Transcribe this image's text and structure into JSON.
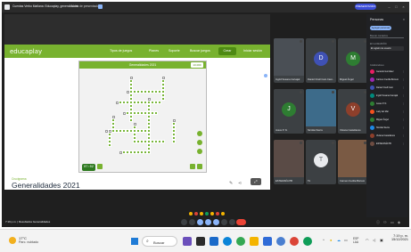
{
  "meet_header": {
    "title": "Cuentas Verbo Mañana: Educaplay, generalidades",
    "tag": "Modo de presentación",
    "pill_label": "PRESENTANDO"
  },
  "educaplay": {
    "logo": "educaplay",
    "nav": [
      "Tipos de juegos",
      "Planes",
      "Soporte",
      "Buscar juegos"
    ],
    "create_label": "Crear",
    "login_label": "Iniciar sesión",
    "game_header_title": "Generalidades 2021",
    "score": "10.000",
    "timer": "07:02",
    "category": "Crucigrama",
    "game_name": "Generalidades 2021",
    "colors": {
      "brand": "#78b22f",
      "dark": "#4e8a13",
      "cell": "#79b63a"
    }
  },
  "participants": [
    {
      "name": "Ingrid Susana Carvajal",
      "kind": "photo",
      "color": "#4a4f55"
    },
    {
      "name": "Daniel Onell Caro Cast...",
      "kind": "avatar",
      "initial": "D",
      "color": "#3f51b5"
    },
    {
      "name": "Miguel Ángel",
      "kind": "avatar",
      "initial": "M",
      "color": "#2e7d32"
    },
    {
      "name": "Jesus P. N.",
      "kind": "avatar",
      "initial": "J",
      "color": "#2e7d32"
    },
    {
      "name": "Nicolás Sierra",
      "kind": "photo",
      "color": "#3d6b8a"
    },
    {
      "name": "Viviana Castellanos",
      "kind": "avatar",
      "initial": "V",
      "color": "#8d3f2b"
    },
    {
      "name": "ESTEFANÍA PB",
      "kind": "photo",
      "color": "#5a4b46"
    },
    {
      "name": "Tú",
      "kind": "avatar",
      "initial": "T",
      "color": "#e8eaed"
    },
    {
      "name": "Carmen Cecilia Borrero",
      "kind": "photo",
      "color": "#7a5a44"
    }
  ],
  "panel": {
    "title": "Personas",
    "add_label": "Agregar personas",
    "search_placeholder": "Buscar contactos",
    "section_label": "EN LA REUNIÓN",
    "select_value": "El registro de usuario",
    "group_label": "Colaboradores",
    "people": [
      {
        "name": "Gerardo González",
        "color": "#e91e63"
      },
      {
        "name": "Carmen Cecilia Borrero",
        "color": "#9c27b0"
      },
      {
        "name": "Daniel Onell Caro",
        "color": "#3f51b5"
      },
      {
        "name": "Ingrid Susana Carvajal",
        "color": "#00897b"
      },
      {
        "name": "Jesus P. N.",
        "color": "#2e7d32"
      },
      {
        "name": "Lady del Mar",
        "color": "#f4511e"
      },
      {
        "name": "Miguel Ángel",
        "color": "#2e7d32"
      },
      {
        "name": "Nicolás Sierra",
        "color": "#1e88e5"
      },
      {
        "name": "Viviana Castellanos",
        "color": "#8d3f2b"
      },
      {
        "name": "ESTEFANÍA PB",
        "color": "#6d4c41"
      }
    ]
  },
  "meetbar": {
    "time_label": "7:19 p.m. | Resultados Generalidades"
  },
  "taskbar": {
    "temp": "17°C",
    "weather": "Parc. nublado",
    "search_label": "Buscar",
    "lang": "ESP\nLAA",
    "time": "7:19 p. m.",
    "date": "15/12/2021"
  }
}
